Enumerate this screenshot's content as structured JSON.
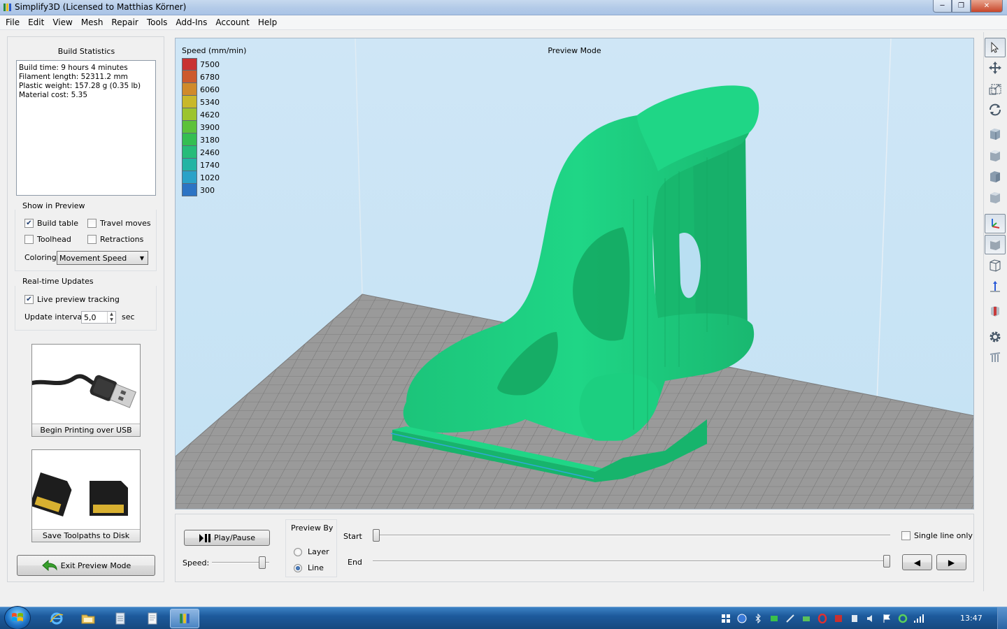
{
  "window": {
    "title": "Simplify3D (Licensed to Matthias Körner)",
    "controls": {
      "minimize": "─",
      "maximize": "❐",
      "close": "✕"
    }
  },
  "menu": [
    "File",
    "Edit",
    "View",
    "Mesh",
    "Repair",
    "Tools",
    "Add-Ins",
    "Account",
    "Help"
  ],
  "build_statistics": {
    "title": "Build Statistics",
    "lines": [
      "Build time: 9 hours 4 minutes",
      "Filament length: 52311.2 mm",
      "Plastic weight: 157.28 g (0.35 lb)",
      "Material cost: 5.35"
    ]
  },
  "show_in_preview": {
    "title": "Show in Preview",
    "build_table": {
      "label": "Build table",
      "checked": true
    },
    "travel_moves": {
      "label": "Travel moves",
      "checked": false
    },
    "toolhead": {
      "label": "Toolhead",
      "checked": false
    },
    "retractions": {
      "label": "Retractions",
      "checked": false
    },
    "coloring_label": "Coloring",
    "coloring_value": "Movement Speed"
  },
  "realtime_updates": {
    "title": "Real-time Updates",
    "live_preview": {
      "label": "Live preview tracking",
      "checked": true
    },
    "interval_label": "Update interval",
    "interval_value": "5,0",
    "interval_unit": "sec"
  },
  "actions": {
    "usb_label": "Begin Printing over USB",
    "disk_label": "Save Toolpaths to Disk",
    "exit_label": "Exit Preview Mode"
  },
  "viewport": {
    "mode_label": "Preview Mode",
    "model_color": "#1fd686",
    "legend": {
      "title": "Speed (mm/min)",
      "entries": [
        {
          "value": "7500",
          "color": "#c83232"
        },
        {
          "value": "6780",
          "color": "#cc5a2e"
        },
        {
          "value": "6060",
          "color": "#d08a2a"
        },
        {
          "value": "5340",
          "color": "#c8b82a"
        },
        {
          "value": "4620",
          "color": "#9cc42e"
        },
        {
          "value": "3900",
          "color": "#5cc23a"
        },
        {
          "value": "3180",
          "color": "#34be52"
        },
        {
          "value": "2460",
          "color": "#26bc7a"
        },
        {
          "value": "1740",
          "color": "#22b4a4"
        },
        {
          "value": "1020",
          "color": "#2aa2c8"
        },
        {
          "value": "300",
          "color": "#2c74c4"
        }
      ]
    }
  },
  "toolbar_icons": [
    "select-arrow-icon",
    "move-icon",
    "scale-icon",
    "rotate-icon",
    "view-cube-front-icon",
    "view-cube-top-icon",
    "view-cube-side-icon",
    "view-cube-iso-icon",
    "axes-icon",
    "solid-view-icon",
    "wireframe-view-icon",
    "normals-icon",
    "cross-section-icon",
    "settings-gear-icon",
    "supports-icon"
  ],
  "playback": {
    "play_label": "Play/Pause",
    "speed_label": "Speed:",
    "speed_fraction": 0.93,
    "preview_by_title": "Preview By",
    "layer_label": "Layer",
    "line_label": "Line",
    "preview_by_selected": "Line",
    "start_label": "Start",
    "end_label": "End",
    "start_fraction": 0.0,
    "end_fraction": 1.0,
    "single_line_label": "Single line only",
    "single_line_checked": false,
    "prev_symbol": "◀",
    "next_symbol": "▶"
  },
  "taskbar": {
    "clock": "13:47",
    "tasks": [
      "internet-explorer-icon",
      "file-explorer-icon",
      "notepad-icon",
      "document-icon",
      "simplify3d-icon"
    ]
  }
}
